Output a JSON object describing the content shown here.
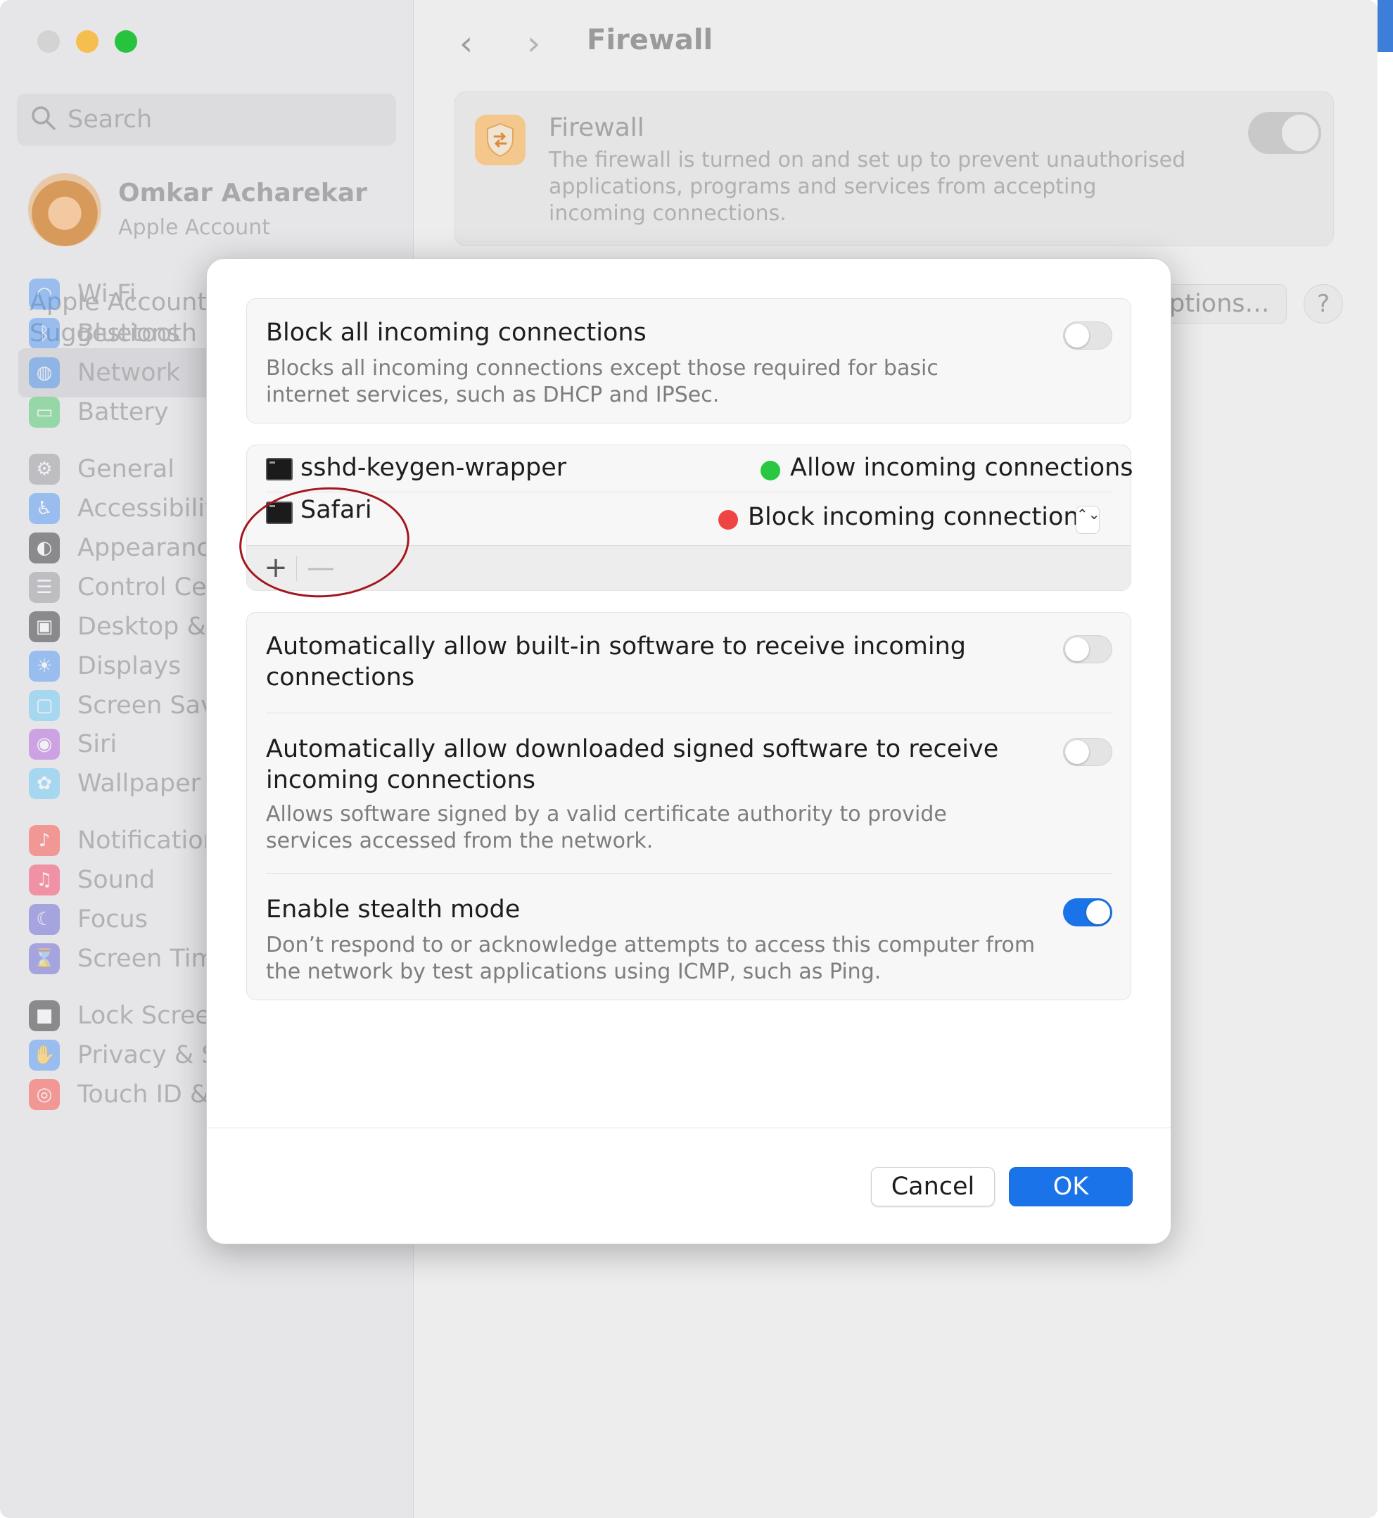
{
  "window": {
    "title": "Firewall",
    "traffic_lights": [
      "close",
      "minimize",
      "zoom"
    ]
  },
  "sidebar": {
    "search_placeholder": "Search",
    "account": {
      "name": "Omkar Acharekar",
      "subtitle": "Apple Account"
    },
    "suggestions_line1": "Apple Account",
    "suggestions_line2": "Suggestions",
    "items": [
      {
        "label": "Wi-Fi",
        "icon": "wifi-icon",
        "color": "#3a8ef6"
      },
      {
        "label": "Bluetooth",
        "icon": "bluetooth-icon",
        "color": "#3a8ef6"
      },
      {
        "label": "Network",
        "icon": "globe-icon",
        "color": "#3a8ef6",
        "selected": true
      },
      {
        "label": "Battery",
        "icon": "battery-icon",
        "color": "#34c759"
      },
      {
        "label": "General",
        "icon": "gear-icon",
        "color": "#8e8e93"
      },
      {
        "label": "Accessibilit",
        "icon": "accessibility-icon",
        "color": "#3a8ef6"
      },
      {
        "label": "Appearanc",
        "icon": "appearance-icon",
        "color": "#1d1d1f"
      },
      {
        "label": "Control Ce",
        "icon": "control-centre-icon",
        "color": "#8e8e93"
      },
      {
        "label": "Desktop &",
        "icon": "desktop-icon",
        "color": "#1d1d1f"
      },
      {
        "label": "Displays",
        "icon": "displays-icon",
        "color": "#3a8ef6"
      },
      {
        "label": "Screen Sav",
        "icon": "screen-saver-icon",
        "color": "#5ac8fa"
      },
      {
        "label": "Siri",
        "icon": "siri-icon",
        "color": "#af52de"
      },
      {
        "label": "Wallpaper",
        "icon": "wallpaper-icon",
        "color": "#5ac8fa"
      },
      {
        "label": "Notification",
        "icon": "notifications-icon",
        "color": "#ff3b30"
      },
      {
        "label": "Sound",
        "icon": "sound-icon",
        "color": "#ff2d55"
      },
      {
        "label": "Focus",
        "icon": "focus-icon",
        "color": "#5856d6"
      },
      {
        "label": "Screen Time",
        "icon": "screen-time-icon",
        "color": "#5856d6"
      },
      {
        "label": "Lock Screen",
        "icon": "lock-icon",
        "color": "#1d1d1f"
      },
      {
        "label": "Privacy & Security",
        "icon": "hand-icon",
        "color": "#3a8ef6"
      },
      {
        "label": "Touch ID & Password",
        "icon": "fingerprint-icon",
        "color": "#ff3b30"
      }
    ]
  },
  "content": {
    "nav_back": "‹",
    "nav_forward": "›",
    "title": "Firewall",
    "firewall_card": {
      "title": "Firewall",
      "description": "The firewall is turned on and set up to prevent unauthorised applications, programs and services from accepting incoming connections.",
      "enabled": true
    },
    "options_button": "ptions…",
    "help_button": "?"
  },
  "modal": {
    "block_all": {
      "title": "Block all incoming connections",
      "description": "Blocks all incoming connections except those required for basic internet services, such as DHCP and IPSec.",
      "enabled": false
    },
    "apps": [
      {
        "name": "sshd-keygen-wrapper",
        "status": "Allow incoming connections",
        "status_color": "#28c840"
      },
      {
        "name": "Safari",
        "status": "Block incoming connections",
        "status_color": "#ef4444"
      }
    ],
    "add_label": "+",
    "remove_label": "—",
    "stepper_symbol": "⌃⌄",
    "auto_builtin": {
      "title_line1": "Automatically allow built-in software to receive incoming",
      "title_line2": "connections",
      "enabled": false
    },
    "auto_signed": {
      "title_line1": "Automatically allow downloaded signed software to receive",
      "title_line2": "incoming connections",
      "description": "Allows software signed by a valid certificate authority to provide services accessed from the network.",
      "enabled": false
    },
    "stealth": {
      "title": "Enable stealth mode",
      "description": "Don’t respond to or acknowledge attempts to access this computer from the network by test applications using ICMP, such as Ping.",
      "enabled": true
    },
    "cancel_label": "Cancel",
    "ok_label": "OK",
    "accent_color": "#1a73e8"
  }
}
